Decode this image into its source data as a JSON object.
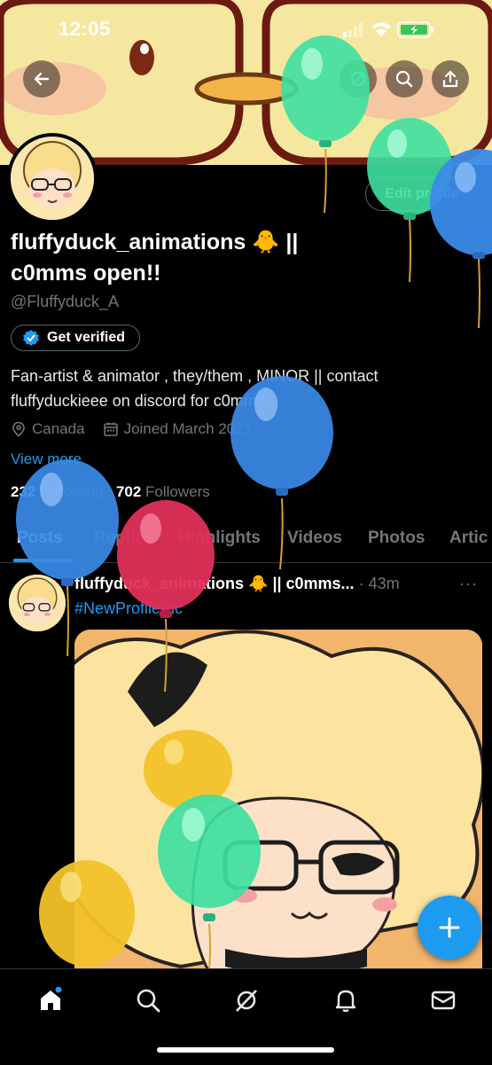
{
  "status_bar": {
    "time": "12:05"
  },
  "profile": {
    "display_name": "fluffyduck_animations 🐥 || c0mms open!!",
    "handle": "@Fluffyduck_A",
    "get_verified_label": "Get verified",
    "edit_profile_label": "Edit profile",
    "bio": "Fan-artist & animator , they/them , MINOR || contact fluffyduckieee on discord for c0mms :)",
    "location": "Canada",
    "joined": "Joined March 2021",
    "view_more": "View more",
    "following_count": "232",
    "following_label": "Following",
    "followers_count": "702",
    "followers_label": "Followers"
  },
  "tabs": [
    {
      "label": "Posts"
    },
    {
      "label": "Replies"
    },
    {
      "label": "Highlights"
    },
    {
      "label": "Videos"
    },
    {
      "label": "Photos"
    },
    {
      "label": "Artic"
    }
  ],
  "post": {
    "author": "fluffyduck_animations 🐥 || c0mms...",
    "time": "· 43m",
    "more": "···",
    "hashtag": "#NewProfilePic"
  },
  "icons": {
    "back": "back-arrow-icon",
    "grok": "grok-icon",
    "search": "search-icon",
    "share": "share-icon",
    "verified": "verified-badge-icon",
    "location": "location-pin-icon",
    "calendar": "calendar-icon",
    "compose": "plus-icon",
    "nav": [
      "home-icon",
      "search-icon",
      "grok-icon",
      "bell-icon",
      "mail-icon"
    ]
  },
  "colors": {
    "accent": "#1d9bf0",
    "background": "#000000",
    "muted": "#71767b"
  }
}
